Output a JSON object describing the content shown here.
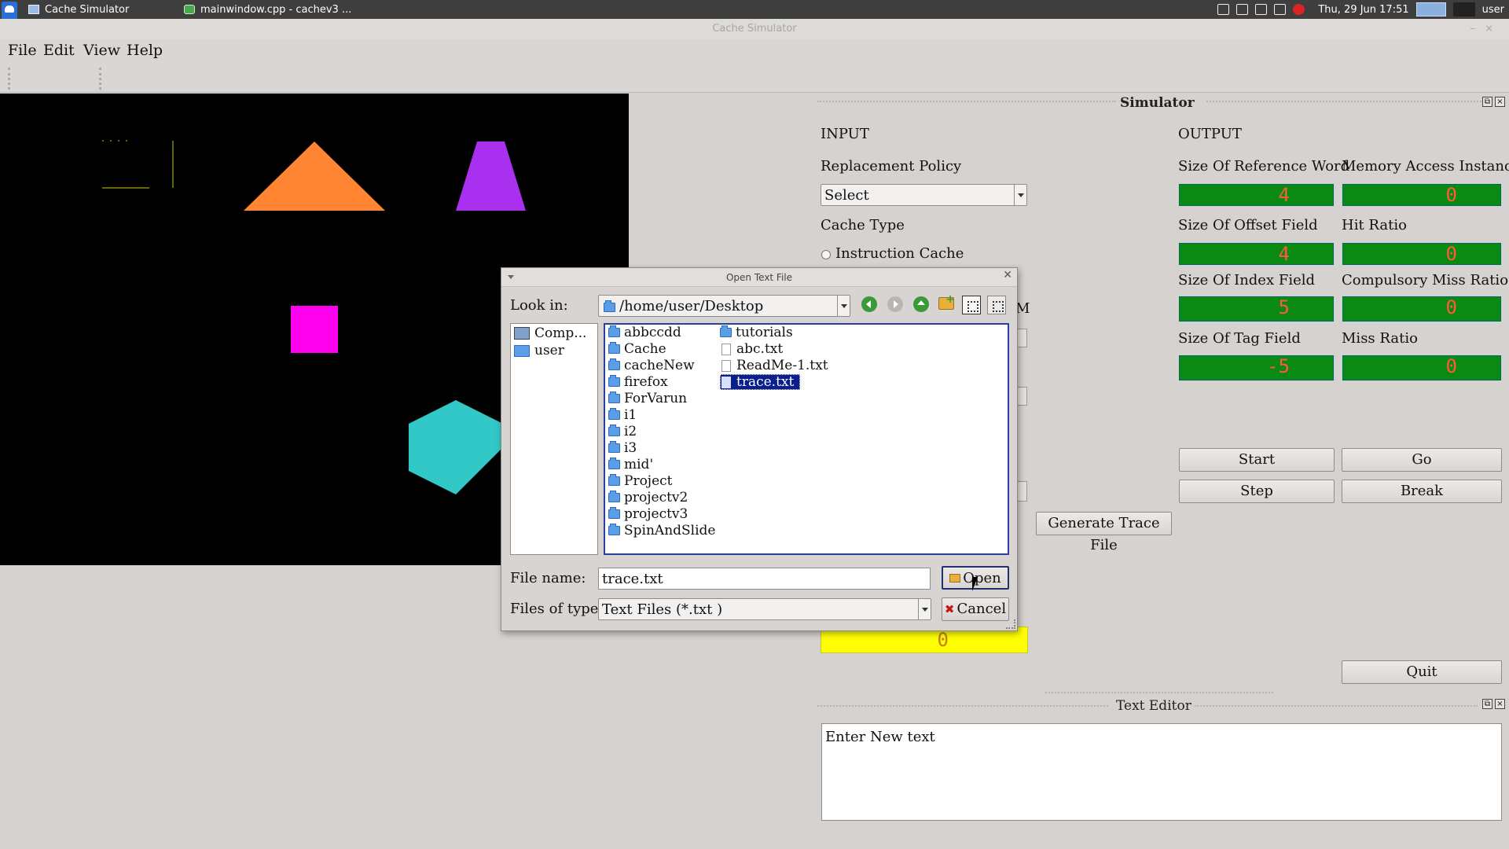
{
  "taskbar": {
    "tasks": [
      {
        "label": "Cache Simulator",
        "icon": "window-icon"
      },
      {
        "label": "mainwindow.cpp - cachev3 ...",
        "icon": "qt-creator-icon"
      }
    ],
    "clock": "Thu, 29 Jun  17:51",
    "user": "user"
  },
  "window": {
    "title": "Cache Simulator"
  },
  "menu": {
    "file": "File",
    "edit": "Edit",
    "view": "View",
    "help": "Help"
  },
  "colors": {
    "lcd_green": "#0a8a12",
    "lcd_digits": "#ff5a3a",
    "yellow_lcd": "#ffff00",
    "selection": "#0a1e8c",
    "triangle": "#ff8533",
    "trapezoid": "#a830ee",
    "square": "#ff00ee",
    "hexagon": "#32c8c8",
    "canvas_line": "#c8c800"
  },
  "simulator": {
    "title": "Simulator",
    "input_heading": "INPUT",
    "output_heading": "OUTPUT",
    "replacement_policy_label": "Replacement Policy",
    "replacement_policy_value": "Select",
    "cache_type_label": "Cache Type",
    "instruction_cache_label": "Instruction Cache",
    "partial_label": "M",
    "generate_trace_button": "Generate Trace File",
    "outputs": [
      {
        "label": "Size Of Reference Word",
        "value": "4"
      },
      {
        "label": "Memory Access Instance",
        "value": "0"
      },
      {
        "label": "Size Of Offset Field",
        "value": "4"
      },
      {
        "label": "Hit Ratio",
        "value": "0"
      },
      {
        "label": "Size Of Index Field",
        "value": "5"
      },
      {
        "label": "Compulsory Miss Ratio",
        "value": "0"
      },
      {
        "label": "Size Of Tag Field",
        "value": "-5"
      },
      {
        "label": "Miss Ratio",
        "value": "0"
      }
    ],
    "yellow_display_value": "0",
    "buttons": {
      "start": "Start",
      "go": "Go",
      "step": "Step",
      "break": "Break",
      "quit": "Quit"
    }
  },
  "text_editor": {
    "title": "Text Editor",
    "content": "Enter New text"
  },
  "dialog": {
    "title": "Open Text File",
    "look_in_label": "Look in:",
    "look_in_path": "/home/user/Desktop",
    "sidebar": [
      "Comp...",
      "user"
    ],
    "folders_col1": [
      "abbccdd",
      "Cache",
      "cacheNew",
      "firefox",
      "ForVarun",
      "i1",
      "i2",
      "i3",
      "mid'",
      "Project",
      "projectv2",
      "projectv3",
      "SpinAndSlide"
    ],
    "col2": [
      {
        "name": "tutorials",
        "kind": "folder"
      },
      {
        "name": "abc.txt",
        "kind": "file"
      },
      {
        "name": "ReadMe-1.txt",
        "kind": "file"
      },
      {
        "name": "trace.txt",
        "kind": "file",
        "selected": true
      }
    ],
    "file_name_label": "File name:",
    "file_name_value": "trace.txt",
    "files_of_type_label": "Files of type:",
    "files_of_type_value": "Text Files (*.txt )",
    "open_button": "Open",
    "cancel_button": "Cancel"
  }
}
